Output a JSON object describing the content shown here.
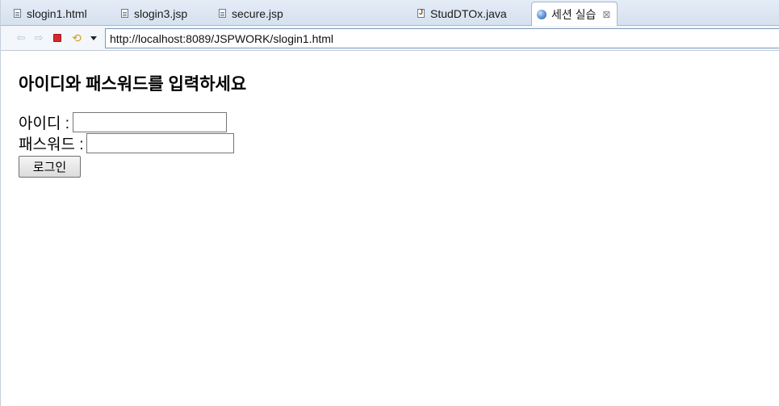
{
  "tabs": [
    {
      "label": "slogin1.html",
      "icon": "html-file-icon",
      "active": false
    },
    {
      "label": "slogin3.jsp",
      "icon": "jsp-file-icon",
      "active": false
    },
    {
      "label": "secure.jsp",
      "icon": "jsp-file-icon",
      "active": false
    },
    {
      "label": "StudDTOx.java",
      "icon": "java-file-icon",
      "active": false
    },
    {
      "label": "세션 실습",
      "icon": "globe-icon",
      "active": true,
      "close": "⊠"
    }
  ],
  "toolbar": {
    "back_icon": "⇦",
    "forward_icon": "⇨",
    "refresh_icon": "⟲",
    "url": "http://localhost:8089/JSPWORK/slogin1.html"
  },
  "page": {
    "heading": "아이디와 패스워드를 입력하세요",
    "id_label": "아이디 :",
    "id_value": "",
    "pw_label": "패스워드 :",
    "pw_value": "",
    "submit_label": "로그인"
  },
  "colors": {
    "tabbar": "#d6e1ef",
    "url_border": "#7e9bbd",
    "stop": "#d9262c"
  }
}
